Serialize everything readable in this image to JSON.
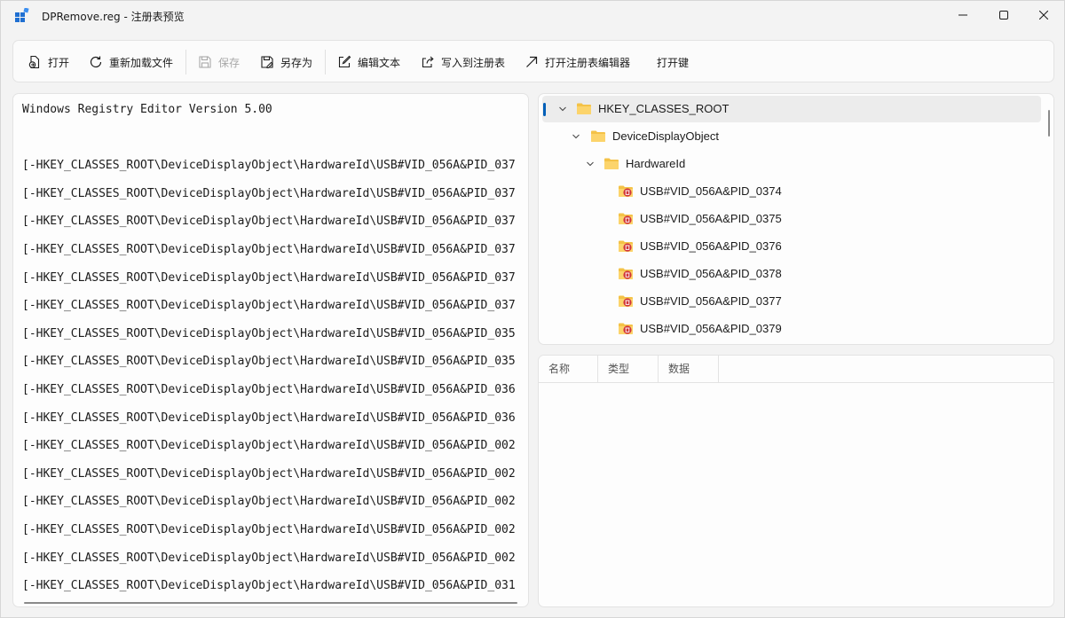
{
  "window": {
    "title": "DPRemove.reg - 注册表预览"
  },
  "toolbar": {
    "open": "打开",
    "reload": "重新加载文件",
    "save": "保存",
    "save_as": "另存为",
    "edit_text": "编辑文本",
    "write_registry": "写入到注册表",
    "open_regedit": "打开注册表编辑器",
    "open_key": "打开键"
  },
  "text_panel": {
    "lines": [
      "Windows Registry Editor Version 5.00",
      "",
      "[-HKEY_CLASSES_ROOT\\DeviceDisplayObject\\HardwareId\\USB#VID_056A&PID_037",
      "[-HKEY_CLASSES_ROOT\\DeviceDisplayObject\\HardwareId\\USB#VID_056A&PID_037",
      "[-HKEY_CLASSES_ROOT\\DeviceDisplayObject\\HardwareId\\USB#VID_056A&PID_037",
      "[-HKEY_CLASSES_ROOT\\DeviceDisplayObject\\HardwareId\\USB#VID_056A&PID_037",
      "[-HKEY_CLASSES_ROOT\\DeviceDisplayObject\\HardwareId\\USB#VID_056A&PID_037",
      "[-HKEY_CLASSES_ROOT\\DeviceDisplayObject\\HardwareId\\USB#VID_056A&PID_037",
      "[-HKEY_CLASSES_ROOT\\DeviceDisplayObject\\HardwareId\\USB#VID_056A&PID_035",
      "[-HKEY_CLASSES_ROOT\\DeviceDisplayObject\\HardwareId\\USB#VID_056A&PID_035",
      "[-HKEY_CLASSES_ROOT\\DeviceDisplayObject\\HardwareId\\USB#VID_056A&PID_036",
      "[-HKEY_CLASSES_ROOT\\DeviceDisplayObject\\HardwareId\\USB#VID_056A&PID_036",
      "[-HKEY_CLASSES_ROOT\\DeviceDisplayObject\\HardwareId\\USB#VID_056A&PID_002",
      "[-HKEY_CLASSES_ROOT\\DeviceDisplayObject\\HardwareId\\USB#VID_056A&PID_002",
      "[-HKEY_CLASSES_ROOT\\DeviceDisplayObject\\HardwareId\\USB#VID_056A&PID_002",
      "[-HKEY_CLASSES_ROOT\\DeviceDisplayObject\\HardwareId\\USB#VID_056A&PID_002",
      "[-HKEY_CLASSES_ROOT\\DeviceDisplayObject\\HardwareId\\USB#VID_056A&PID_002",
      "[-HKEY_CLASSES_ROOT\\DeviceDisplayObject\\HardwareId\\USB#VID_056A&PID_031"
    ]
  },
  "tree": {
    "root": "HKEY_CLASSES_ROOT",
    "level1": "DeviceDisplayObject",
    "level2": "HardwareId",
    "children": [
      "USB#VID_056A&PID_0374",
      "USB#VID_056A&PID_0375",
      "USB#VID_056A&PID_0376",
      "USB#VID_056A&PID_0378",
      "USB#VID_056A&PID_0377",
      "USB#VID_056A&PID_0379"
    ]
  },
  "values": {
    "col_name": "名称",
    "col_type": "类型",
    "col_data": "数据"
  },
  "colors": {
    "accent": "#005fb8",
    "folder": "#f4c247",
    "delete_badge": "#d13438"
  }
}
